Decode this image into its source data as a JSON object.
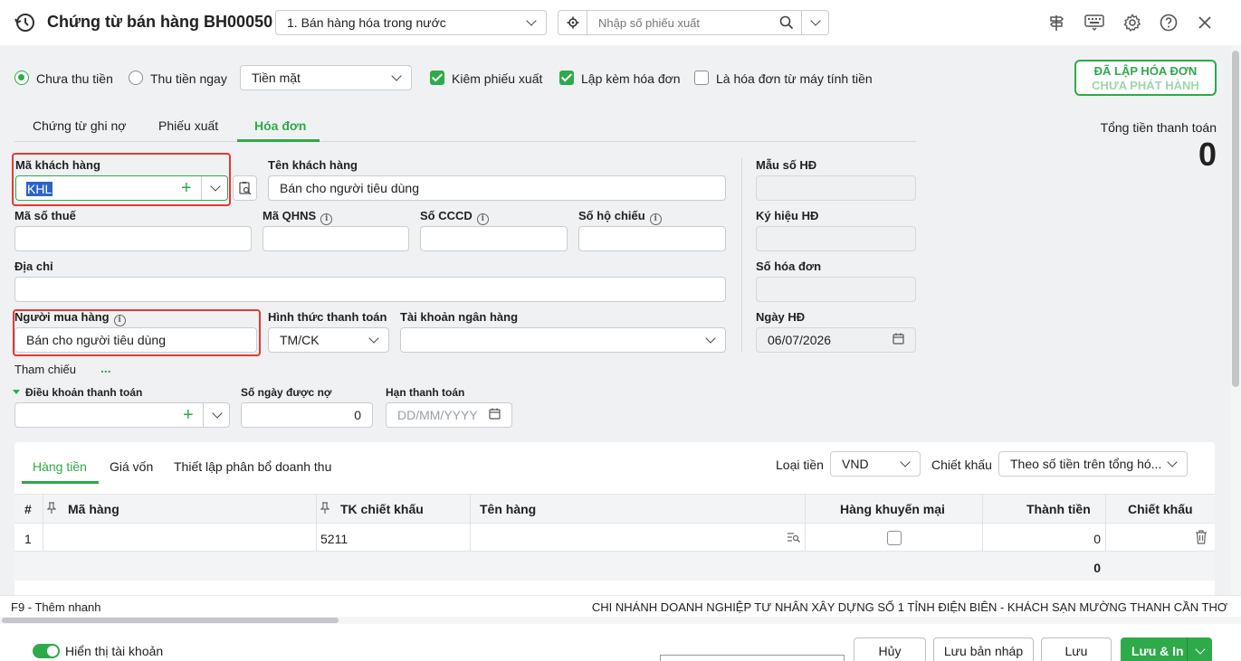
{
  "window": {
    "title": "Chứng từ bán hàng BH00050",
    "type_select": "1. Bán hàng hóa trong nước",
    "search_placeholder": "Nhập số phiếu xuất"
  },
  "options": {
    "radio_unpaid": "Chưa thu tiền",
    "radio_paid": "Thu tiền ngay",
    "payment_method": "Tiền mặt",
    "check_export": "Kiêm phiếu xuất",
    "check_invoice": "Lập kèm hóa đơn",
    "check_cash_register": "Là hóa đơn từ máy tính tiền"
  },
  "status_badge": {
    "line1": "ĐÃ LẬP HÓA ĐƠN",
    "line2": "CHƯA PHÁT HÀNH"
  },
  "total": {
    "label": "Tổng tiền thanh toán",
    "value": "0"
  },
  "tabs": [
    "Chứng từ ghi nợ",
    "Phiếu xuất",
    "Hóa đơn"
  ],
  "form": {
    "customer_code_label": "Mã khách hàng",
    "customer_code": "KHL",
    "customer_name_label": "Tên khách hàng",
    "customer_name": "Bán cho người tiêu dùng",
    "tax_code_label": "Mã số thuế",
    "qhns_label": "Mã QHNS",
    "cccd_label": "Số CCCD",
    "passport_label": "Số hộ chiếu",
    "address_label": "Địa chỉ",
    "buyer_label": "Người mua hàng",
    "buyer": "Bán cho người tiêu dùng",
    "payment_form_label": "Hình thức thanh toán",
    "payment_form": "TM/CK",
    "bank_account_label": "Tài khoản ngân hàng",
    "reference_label": "Tham chiếu",
    "reference_more": "...",
    "payment_terms_label": "Điều khoản thanh toán",
    "credit_days_label": "Số ngày được nợ",
    "credit_days": "0",
    "due_date_label": "Hạn thanh toán",
    "due_date_placeholder": "DD/MM/YYYY",
    "invoice_template_label": "Mẫu số HĐ",
    "invoice_symbol_label": "Ký hiệu HĐ",
    "invoice_number_label": "Số hóa đơn",
    "invoice_date_label": "Ngày HĐ",
    "invoice_date": "06/07/2026"
  },
  "detail": {
    "tabs": [
      "Hàng tiền",
      "Giá vốn",
      "Thiết lập phân bổ doanh thu"
    ],
    "currency_label": "Loại tiền",
    "currency": "VND",
    "discount_label": "Chiết khấu",
    "discount_mode": "Theo số tiền trên tổng hó...",
    "columns": [
      "#",
      "Mã hàng",
      "TK chiết khấu",
      "Tên hàng",
      "Hàng khuyến mại",
      "Thành tiền",
      "Chiết khấu"
    ],
    "rows": [
      {
        "num": "1",
        "item_code": "",
        "discount_account": "5211",
        "item_name": "",
        "promo": false,
        "amount": "0",
        "discount": ""
      }
    ],
    "sum_amount": "0"
  },
  "status_bar": {
    "shortcut": "F9 - Thêm nhanh",
    "company": "CHI NHÁNH DOANH NGHIỆP TƯ NHÂN XÂY DỰNG SỐ 1 TỈNH ĐIỆN BIÊN - KHÁCH SẠN MƯỜNG THANH CẦN THƠ"
  },
  "footer": {
    "toggle_label": "Hiển thị tài khoản",
    "cancel": "Hủy",
    "save_draft": "Lưu bản nháp",
    "save": "Lưu",
    "save_print": "Lưu & In"
  },
  "colors": {
    "accent": "#2eaa4a",
    "highlight_border": "#e53935"
  }
}
